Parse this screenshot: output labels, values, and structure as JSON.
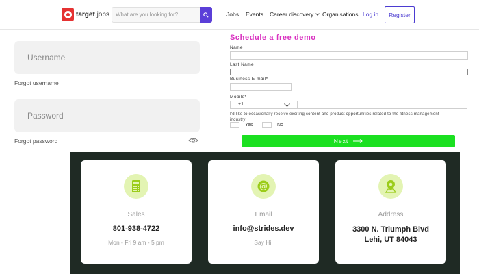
{
  "header": {
    "logo_brand": "target",
    "logo_suffix": "jobs",
    "search_placeholder": "What are you looking for?",
    "nav": [
      "Jobs",
      "Events",
      "Career discovery",
      "Organisations"
    ],
    "login_label": "Log in",
    "register_label": "Register"
  },
  "login_form": {
    "username_placeholder": "Username",
    "forgot_username": "Forgot username",
    "password_placeholder": "Password",
    "forgot_password": "Forgot password"
  },
  "demo_form": {
    "title": "Schedule a free demo",
    "name_label": "Name",
    "last_name_label": "Last Name",
    "email_label": "Business E-mail*",
    "mobile_label": "Mobile*",
    "mobile_code": "+1",
    "consent_text": "I'd like to occasionally receive exciting content and product opportunities related to the fitness management industry",
    "yes_label": "Yes",
    "no_label": "No",
    "next_label": "Next"
  },
  "contact": {
    "sales": {
      "title": "Sales",
      "value": "801-938-4722",
      "sub": "Mon - Fri 9 am - 5 pm",
      "icon": "phone-icon"
    },
    "email": {
      "title": "Email",
      "value": "info@strides.dev",
      "sub": "Say Hi!",
      "icon": "at-icon"
    },
    "address": {
      "title": "Address",
      "line1": "3300 N. Triumph Blvd",
      "line2": "Lehi, UT 84043",
      "icon": "map-pin-icon"
    }
  },
  "colors": {
    "brand_red": "#e53232",
    "accent_purple": "#4b3bd1",
    "demo_title_magenta": "#d930c0",
    "next_green": "#1be021",
    "band_dark": "#1f2a24",
    "icon_bg_lime": "#e3f4b3"
  }
}
